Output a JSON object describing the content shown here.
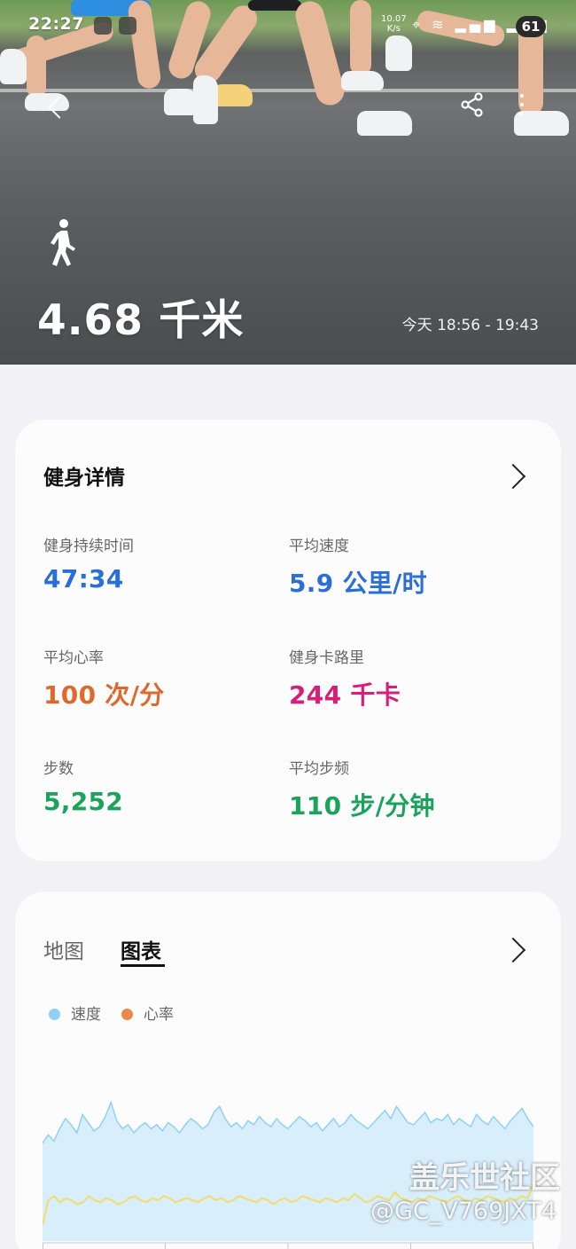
{
  "status_bar": {
    "time": "22:27",
    "net_speed": "10.07\nK/s",
    "battery": "61"
  },
  "hero": {
    "distance": "4.68 千米",
    "time_range": "今天 18:56 - 19:43"
  },
  "details": {
    "title": "健身详情",
    "metrics": [
      {
        "label": "健身持续时间",
        "value": "47:34"
      },
      {
        "label": "平均速度",
        "value": "5.9 公里/时"
      },
      {
        "label": "平均心率",
        "value": "100 次/分"
      },
      {
        "label": "健身卡路里",
        "value": "244 千卡"
      },
      {
        "label": "步数",
        "value": "5,252"
      },
      {
        "label": "平均步频",
        "value": "110 步/分钟"
      }
    ]
  },
  "chart_card": {
    "tabs": [
      {
        "label": "地图",
        "active": false
      },
      {
        "label": "图表",
        "active": true
      }
    ],
    "legend": [
      {
        "label": "速度",
        "color": "#8ed1f5"
      },
      {
        "label": "心率",
        "color": "#f0874a"
      }
    ]
  },
  "chart_data": {
    "type": "area",
    "series": [
      {
        "name": "速度",
        "values": [
          48,
          52,
          49,
          55,
          60,
          57,
          53,
          62,
          58,
          54,
          56,
          61,
          68,
          59,
          55,
          57,
          53,
          56,
          58,
          55,
          57,
          54,
          58,
          56,
          53,
          57,
          60,
          58,
          55,
          57,
          63,
          66,
          60,
          56,
          58,
          55,
          59,
          57,
          61,
          58,
          56,
          60,
          57,
          55,
          58,
          61,
          59,
          56,
          58,
          54,
          57,
          60,
          56,
          58,
          62,
          59,
          57,
          55,
          58,
          61,
          64,
          60,
          66,
          62,
          58,
          57,
          60,
          63,
          58,
          60,
          59,
          62,
          57,
          60,
          58,
          56,
          62,
          59,
          57,
          61,
          58,
          55,
          59,
          62,
          65,
          60,
          56
        ]
      },
      {
        "name": "心率",
        "values": [
          8,
          20,
          22,
          19,
          21,
          20,
          18,
          19,
          22,
          20,
          19,
          21,
          20,
          18,
          19,
          21,
          22,
          20,
          19,
          21,
          20,
          22,
          21,
          19,
          20,
          21,
          20,
          19,
          21,
          22,
          20,
          21,
          19,
          20,
          22,
          21,
          20,
          19,
          21,
          20,
          18,
          20,
          21,
          19,
          20,
          22,
          21,
          20,
          19,
          21,
          20,
          19,
          21,
          20,
          23,
          21,
          19,
          20,
          22,
          21,
          20,
          24,
          21,
          20,
          19,
          21,
          20,
          22,
          21,
          20,
          19,
          21,
          22,
          20,
          19,
          21,
          20,
          22,
          21,
          20,
          19,
          21,
          20,
          22,
          21,
          28
        ]
      }
    ]
  },
  "watermark": {
    "line1": "盖乐世社区",
    "line2": "@GC_V769JXT4"
  }
}
